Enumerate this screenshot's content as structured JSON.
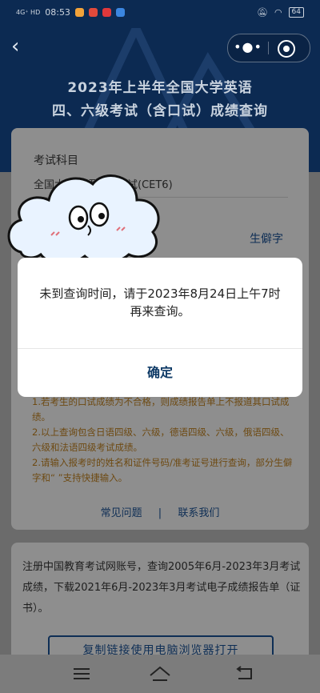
{
  "status_bar": {
    "network": "4G⁺ HD",
    "time": "08:53",
    "battery": "64",
    "app_colors": [
      "#f2a33a",
      "#e24a3b",
      "#e0383b",
      "#3b86e0"
    ]
  },
  "header": {
    "title_line1": "2023年上半年全国大学英语",
    "title_line2": "四、六级考试（含口试）成绩查询"
  },
  "form": {
    "subject_label": "考试科目",
    "subject_value": "全国大学英语六级考试(CET6)",
    "rare_char_label": "生僻字"
  },
  "notes": [
    "1.若考生的口试成绩为不合格，则成绩报告单上不报道其口试成绩。",
    "2.以上查询包含日语四级、六级，德语四级、六级，俄语四级、六级和法语四级考试成绩。",
    "2.请输入报考时的姓名和证件号码/准考证号进行查询，部分生僻字和“ ”支持快捷输入。"
  ],
  "links": {
    "faq": "常见问题",
    "separator": "|",
    "contact": "联系我们"
  },
  "register": {
    "text": "注册中国教育考试网账号，查询2005年6月-2023年3月考试成绩，下载2021年6月-2023年3月考试电子成绩报告单（证书）。",
    "copy_button": "复制链接使用电脑浏览器打开"
  },
  "modal": {
    "message": "未到查询时间，请于2023年8月24日上午7时再来查询。",
    "confirm": "确定"
  },
  "icons": [
    "back-icon",
    "more-icon",
    "close-mini-program-icon",
    "menu-icon",
    "home-icon",
    "return-icon",
    "cloud-mascot"
  ]
}
